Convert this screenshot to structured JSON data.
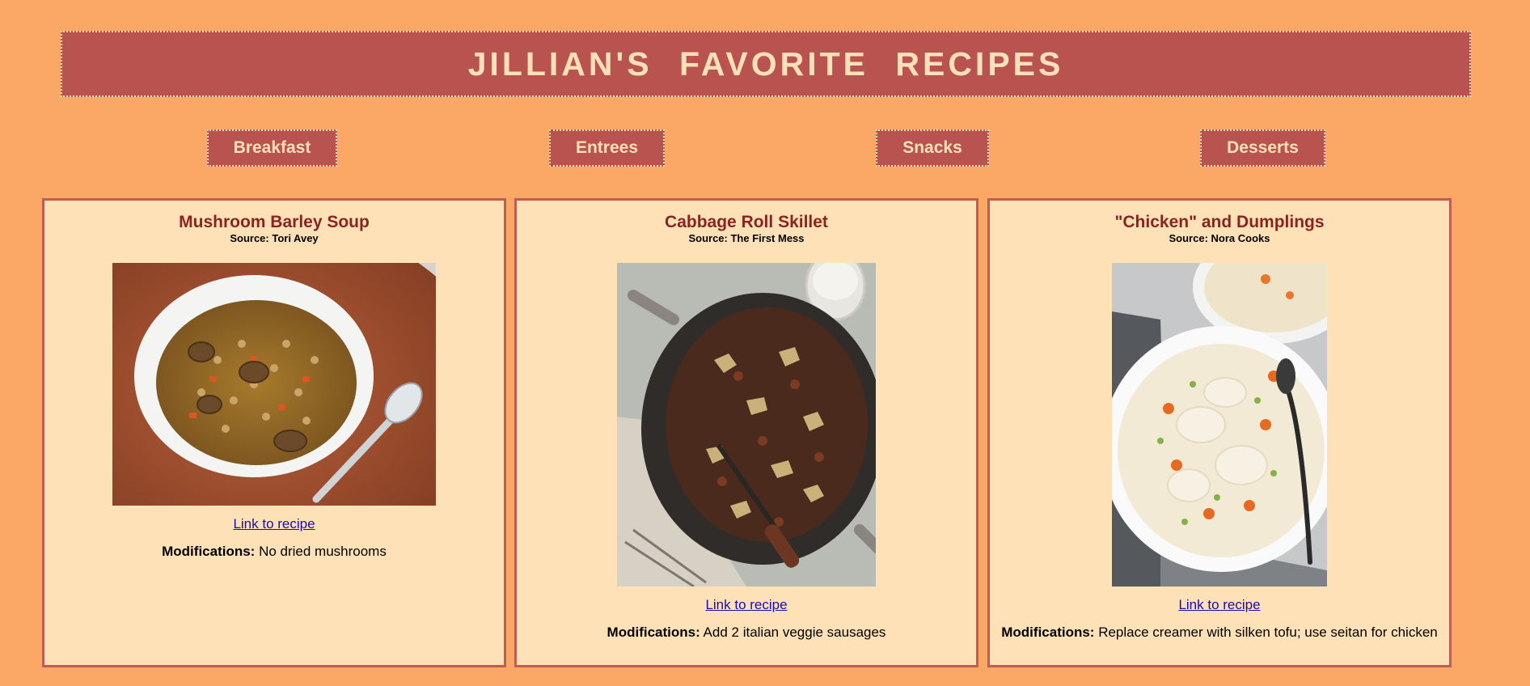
{
  "header": {
    "title": "JILLIAN'S  FAVORITE  RECIPES"
  },
  "nav": [
    {
      "label": "Breakfast"
    },
    {
      "label": "Entrees"
    },
    {
      "label": "Snacks"
    },
    {
      "label": "Desserts"
    }
  ],
  "recipes": [
    {
      "title": "Mushroom Barley Soup",
      "source": "Source: Tori Avey",
      "link_text": "Link to recipe",
      "mods_label": "Modifications:",
      "mods_text": " No dried mushrooms"
    },
    {
      "title": "Cabbage Roll Skillet",
      "source": "Source: The First Mess",
      "link_text": "Link to recipe",
      "mods_label": "Modifications:",
      "mods_text": " Add 2 italian veggie sausages"
    },
    {
      "title": "\"Chicken\" and Dumplings",
      "source": "Source: Nora Cooks",
      "link_text": "Link to recipe",
      "mods_label": "Modifications:",
      "mods_text": " Replace creamer with silken tofu; use seitan for chicken"
    }
  ],
  "colors": {
    "background": "#fba765",
    "accent": "#b9534f",
    "accent_text": "#ffe0b8",
    "card_bg": "#ffe1b8",
    "title_text": "#8b2420",
    "link": "#1a0dab"
  }
}
